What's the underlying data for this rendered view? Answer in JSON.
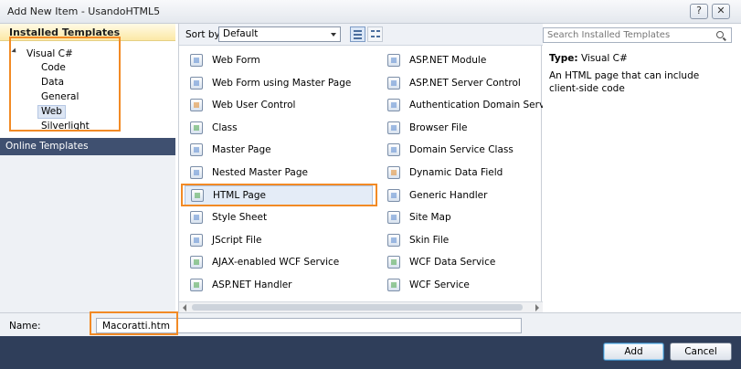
{
  "window": {
    "title": "Add New Item - UsandoHTML5",
    "help_label": "?",
    "close_label": "✕"
  },
  "left": {
    "installed_header": "Installed Templates",
    "tree": [
      {
        "label": "Visual C#",
        "level": 0,
        "expanded": true
      },
      {
        "label": "Code",
        "level": 1
      },
      {
        "label": "Data",
        "level": 1
      },
      {
        "label": "General",
        "level": 1
      },
      {
        "label": "Web",
        "level": 1,
        "selected": true
      },
      {
        "label": "Silverlight",
        "level": 1
      }
    ],
    "online_templates": "Online Templates"
  },
  "sortbar": {
    "label": "Sort by:",
    "value": "Default"
  },
  "templates": {
    "col1": [
      {
        "label": "Web Form",
        "icon": "web-form-icon"
      },
      {
        "label": "Web Form using Master Page",
        "icon": "web-form-master-icon"
      },
      {
        "label": "Web User Control",
        "icon": "user-control-icon"
      },
      {
        "label": "Class",
        "icon": "class-icon"
      },
      {
        "label": "Master Page",
        "icon": "master-page-icon"
      },
      {
        "label": "Nested Master Page",
        "icon": "nested-master-page-icon"
      },
      {
        "label": "HTML Page",
        "icon": "html-page-icon",
        "selected": true
      },
      {
        "label": "Style Sheet",
        "icon": "style-sheet-icon"
      },
      {
        "label": "JScript File",
        "icon": "jscript-file-icon"
      },
      {
        "label": "AJAX-enabled WCF Service",
        "icon": "ajax-wcf-icon"
      },
      {
        "label": "ASP.NET Handler",
        "icon": "aspnet-handler-icon"
      }
    ],
    "col2": [
      {
        "label": "ASP.NET Module",
        "icon": "aspnet-module-icon"
      },
      {
        "label": "ASP.NET Server Control",
        "icon": "server-control-icon"
      },
      {
        "label": "Authentication Domain Service",
        "icon": "auth-domain-service-icon"
      },
      {
        "label": "Browser File",
        "icon": "browser-file-icon"
      },
      {
        "label": "Domain Service Class",
        "icon": "domain-service-icon"
      },
      {
        "label": "Dynamic Data Field",
        "icon": "dynamic-data-icon"
      },
      {
        "label": "Generic Handler",
        "icon": "generic-handler-icon"
      },
      {
        "label": "Site Map",
        "icon": "site-map-icon"
      },
      {
        "label": "Skin File",
        "icon": "skin-file-icon"
      },
      {
        "label": "WCF Data Service",
        "icon": "wcf-data-service-icon"
      },
      {
        "label": "WCF Service",
        "icon": "wcf-service-icon"
      }
    ]
  },
  "details": {
    "search_placeholder": "Search Installed Templates",
    "type_label": "Type:",
    "type_value": "Visual C#",
    "description": "An HTML page that can include client-side code"
  },
  "bottom": {
    "name_label": "Name:",
    "name_value": "Macoratti.htm",
    "add_label": "Add",
    "cancel_label": "Cancel"
  },
  "colors": {
    "highlight": "#f28a25",
    "footer": "#2f3e5a",
    "online_templates": "#3f5070"
  }
}
